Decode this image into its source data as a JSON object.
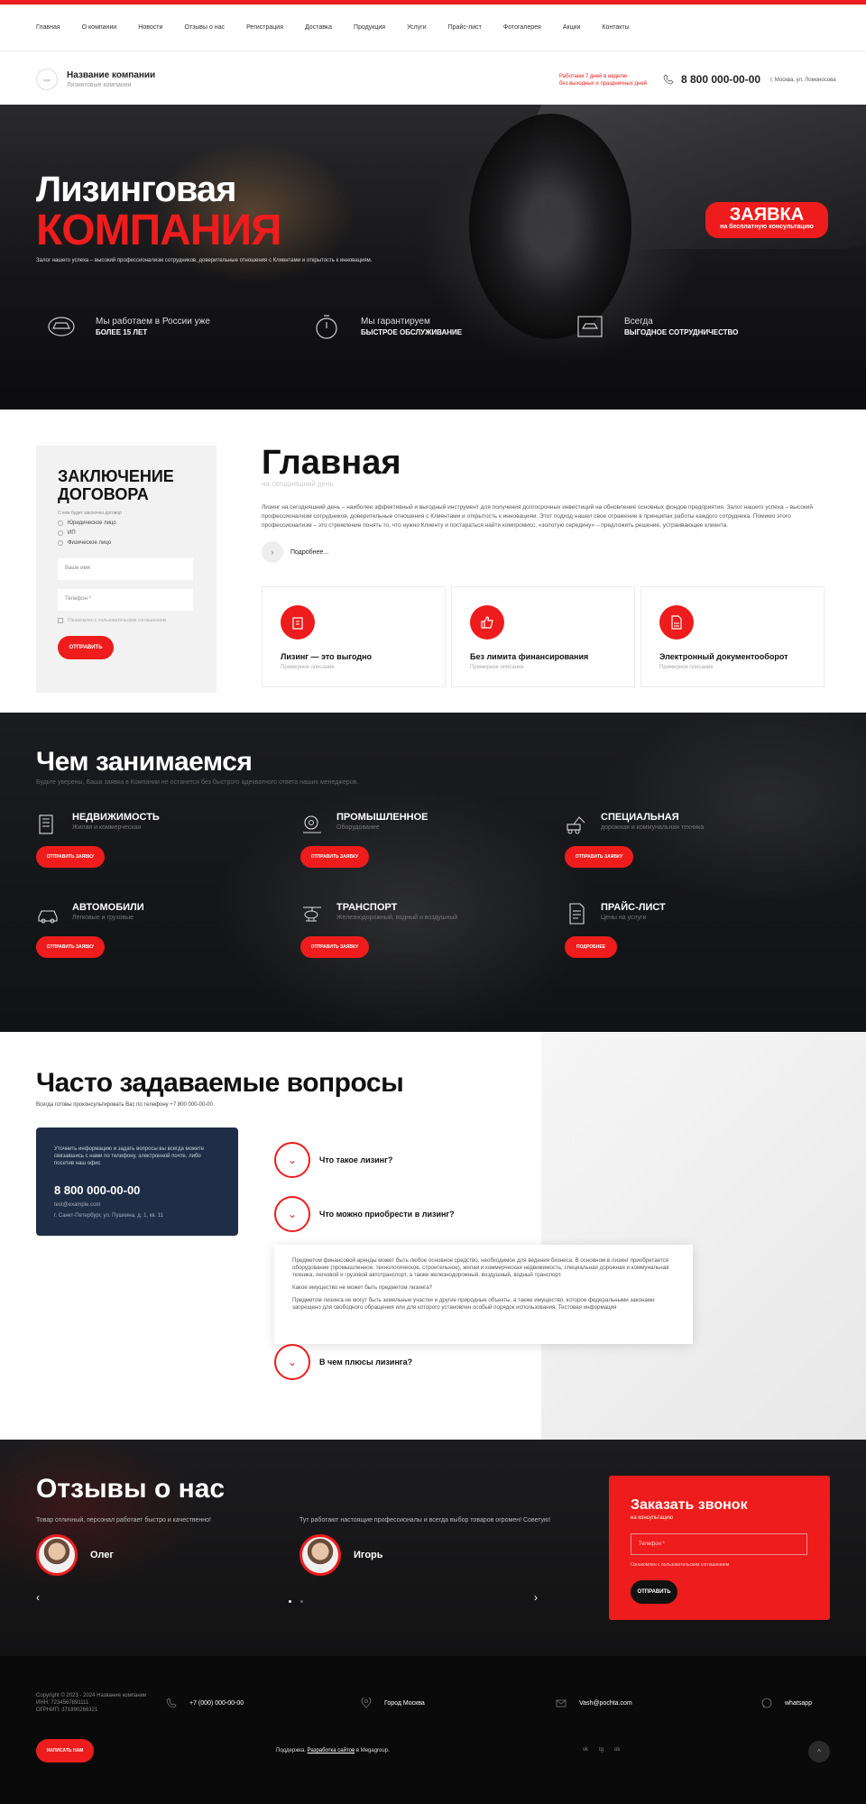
{
  "nav": [
    "Главная",
    "О компании",
    "Новости",
    "Отзывы о нас",
    "Регистрация",
    "Доставка",
    "Продукция",
    "Услуги",
    "Прайс-лист",
    "Фотогалерея",
    "Акции",
    "Контакты"
  ],
  "header": {
    "logo_text": "logo",
    "company_name": "Название компании",
    "company_sub": "Лизинговые компании",
    "work_hours_1": "Работаем 7 дней в неделю",
    "work_hours_2": "без выходных и праздничных дней",
    "phone": "8 800 000-00-00",
    "address": "г. Москва, ул. Ломоносова"
  },
  "hero": {
    "title_1": "Лизинговая",
    "title_2": "КОМПАНИЯ",
    "desc": "Залог нашего успеха – высокий профессионализм сотрудников, доверительные отношения с Клиентами и открытость к инновациям.",
    "request_title": "ЗАЯВКА",
    "request_sub": "на бесплатную консультацию",
    "features": [
      {
        "l1": "Мы работаем в России уже",
        "l2": "БОЛЕЕ 15 ЛЕТ"
      },
      {
        "l1": "Мы гарантируем",
        "l2": "БЫСТРОЕ ОБСЛУЖИВАНИЕ"
      },
      {
        "l1": "Всегда",
        "l2": "ВЫГОДНОЕ СОТРУДНИЧЕСТВО"
      }
    ]
  },
  "contract_form": {
    "title": "ЗАКЛЮЧЕНИЕ ДОГОВОРА",
    "type_label": "С кем будет заключен договор",
    "options": [
      "Юридическое лицо",
      "ИП",
      "Физическое лицо"
    ],
    "name_placeholder": "Ваше имя",
    "phone_placeholder": "Телефон *",
    "agree": "Ознакомлен с пользовательским соглашением",
    "submit": "ОТПРАВИТЬ"
  },
  "main": {
    "title": "Главная",
    "subtitle": "на сегодняшний день",
    "text": "Лизинг на сегодняшний день – наиболее эффективный и выгодный инструмент для получения долгосрочных инвестиций на обновление основных фондов предприятия. Залог нашего успеха – высокий профессионализм сотрудников, доверительные отношения с Клиентами и открытость к инновациям. Этот подход нашел свое отражение в принципах работы каждого сотрудника. Помимо этого профессионализм – это стремление понять то, что нужно Клиенту и постараться найти компромисс, «золотую середину» – предложить решение, устраивающее клиента.",
    "more": "Подробнее...",
    "advantages": [
      {
        "title": "Лизинг — это выгодно",
        "sub": "Примерное описание"
      },
      {
        "title": "Без лимита финансирования",
        "sub": "Примерное описание"
      },
      {
        "title": "Электронный документооборот",
        "sub": "Примерное описание"
      }
    ]
  },
  "services": {
    "title": "Чем занимаемся",
    "subtitle": "Будьте уверены, Ваша заявка в Компании не останется без быстрого адекватного ответа наших менеджеров.",
    "items": [
      {
        "title": "НЕДВИЖИМОСТЬ",
        "sub": "Жилая и коммерческая",
        "btn": "ОТПРАВИТЬ ЗАЯВКУ"
      },
      {
        "title": "ПРОМЫШЛЕННОЕ",
        "sub": "Оборудование",
        "btn": "ОТПРАВИТЬ ЗАЯВКУ"
      },
      {
        "title": "СПЕЦИАЛЬНАЯ",
        "sub": "дорожная и коммунальная техника",
        "btn": "ОТПРАВИТЬ ЗАЯВКУ"
      },
      {
        "title": "АВТОМОБИЛИ",
        "sub": "Легковые и грузовые",
        "btn": "ОТПРАВИТЬ ЗАЯВКУ"
      },
      {
        "title": "ТРАНСПОРТ",
        "sub": "Железнодорожный, водный и воздушный",
        "btn": "ОТПРАВИТЬ ЗАЯВКУ"
      },
      {
        "title": "ПРАЙС-ЛИСТ",
        "sub": "Цены на услуги",
        "btn": "ПОДРОБНЕЕ"
      }
    ]
  },
  "faq": {
    "title": "Часто задаваемые вопросы",
    "subtitle": "Всегда готовы проконсультировать Вас по телефону +7 800 000-00-00",
    "contact_desc": "Уточнить информацию и задать вопросы вы всегда можете связавшись с нами по телефону, электронной почте, либо посетив наш офис",
    "contact_phone": "8 800 000-00-00",
    "contact_email": "test@example.com",
    "contact_address": "г. Санкт-Петербург, ул. Пушкина, д. 1, кв. 11",
    "questions": [
      "Что такое лизинг?",
      "Что можно приобрести в лизинг?",
      "В чем плюсы лизинга?"
    ],
    "answer_p1": "Предметом финансовой аренды может быть любое основное средство, необходимое для ведения бизнеса. В основном в лизинг приобретается оборудование (промышленное, технологическое, строительное), жилая и коммерческая недвижимость, специальная дорожная и коммунальная техника, легковой и грузовой автотранспорт, а также железнодорожный, воздушный, водный транспорт.",
    "answer_p2": "Какое имущество не может быть предметом лизинга?",
    "answer_p3": "Предметом лизинга не могут быть земельные участки и другие природные объекты, а также имущество, которое федеральными законами запрещено для свободного обращения или для которого установлен особый порядок использования. Тестовая информация"
  },
  "reviews": {
    "title": "Отзывы о нас",
    "items": [
      {
        "text": "Товар отличный, персонал работает быстро и качественно!",
        "name": "Олег"
      },
      {
        "text": "Тут работают настоящие профессионалы и всегда выбор товаров огромен! Советую!",
        "name": "Игорь"
      }
    ],
    "callback_title": "Заказать звонок",
    "callback_sub": "на консультацию",
    "callback_placeholder": "Телефон *",
    "callback_agree": "Ознакомлен с пользовательским соглашением",
    "callback_btn": "ОТПРАВИТЬ"
  },
  "footer": {
    "copy_1": "Copyright © 2023 - 2024 Название компании",
    "copy_2": "ИНН: 7234567891111",
    "copy_3": "ОГРНИП: 371890266321",
    "phone": "+7 (000) 000-00-00",
    "city": "Город Москва",
    "email": "Vash@pochta.com",
    "whatsapp": "whatsapp",
    "btn": "НАПИСАТЬ НАМ",
    "dev_1": "Поддержка.",
    "dev_link": "Разработка сайтов",
    "dev_2": "в Megagroup.",
    "social": [
      "vk",
      "tg",
      "ok"
    ],
    "up": "^"
  },
  "colors": {
    "accent": "#ee1c1c",
    "dark": "#111214",
    "contact_card": "#1f2e46"
  }
}
